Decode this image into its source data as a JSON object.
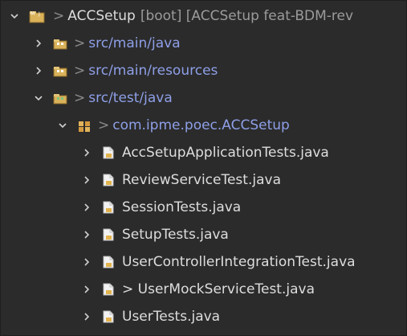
{
  "colors": {
    "background": "#2b2b2b",
    "text": "#dddddd",
    "decoration": "#9b9b9b",
    "package_text": "#8e9fe7"
  },
  "tree": {
    "project": {
      "prefix": ">",
      "name": "ACCSetup",
      "decoration": "[boot] [ACCSetup feat-BDM-rev",
      "icon": "project-folder-icon",
      "state": "expanded"
    },
    "folders": [
      {
        "prefix": ">",
        "label": "src/main/java",
        "icon": "source-folder-icon",
        "state": "collapsed"
      },
      {
        "prefix": ">",
        "label": "src/main/resources",
        "icon": "source-folder-icon",
        "state": "collapsed"
      },
      {
        "prefix": ">",
        "label": "src/test/java",
        "icon": "test-source-folder-icon",
        "state": "expanded"
      }
    ],
    "package": {
      "prefix": ">",
      "label": "com.ipme.poec.ACCSetup",
      "icon": "package-icon",
      "state": "expanded"
    },
    "files": [
      {
        "label": "AccSetupApplicationTests.java",
        "icon": "java-file-icon"
      },
      {
        "label": "ReviewServiceTest.java",
        "icon": "java-file-icon"
      },
      {
        "label": "SessionTests.java",
        "icon": "java-file-icon"
      },
      {
        "label": "SetupTests.java",
        "icon": "java-file-icon"
      },
      {
        "label": "UserControllerIntegrationTest.java",
        "icon": "java-file-icon"
      },
      {
        "label": "> UserMockServiceTest.java",
        "icon": "java-file-icon"
      },
      {
        "label": "UserTests.java",
        "icon": "java-file-icon"
      }
    ]
  }
}
